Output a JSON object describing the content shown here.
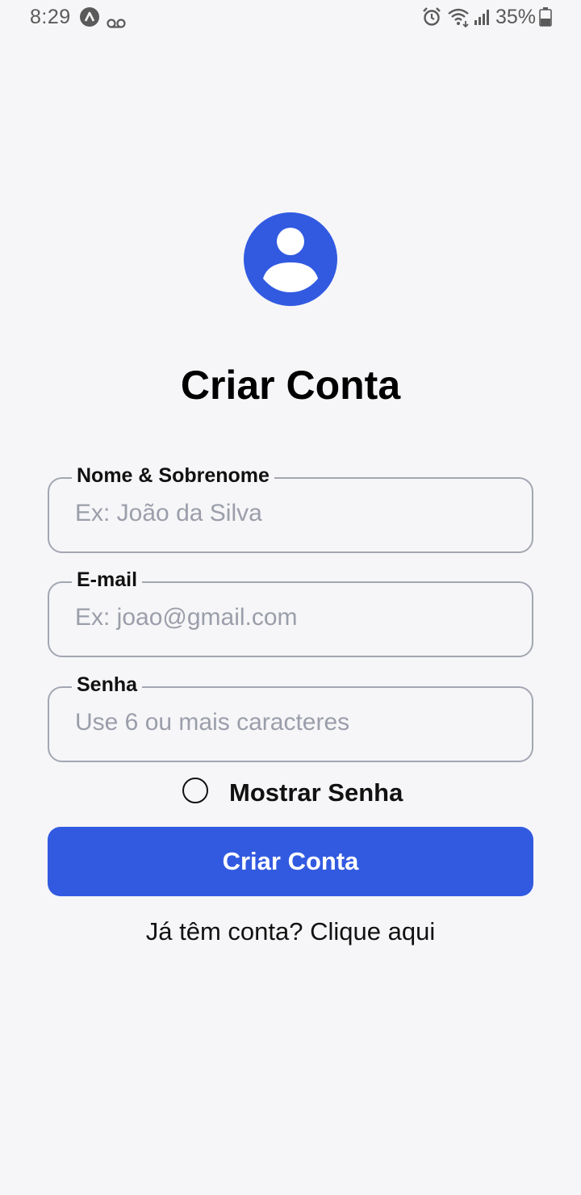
{
  "status_bar": {
    "time": "8:29",
    "battery": "35%",
    "icons": [
      "app-icon",
      "voicemail-icon",
      "alarm-icon",
      "wifi-icon",
      "signal-icon",
      "battery-icon"
    ]
  },
  "colors": {
    "accent": "#325ae1",
    "background": "#f6f6f8",
    "field_border": "#a3a6b3",
    "placeholder": "#9b9eaa"
  },
  "header": {
    "avatar_icon": "user-avatar-icon",
    "title": "Criar Conta"
  },
  "form": {
    "name": {
      "label": "Nome & Sobrenome",
      "placeholder": "Ex: João da Silva",
      "value": ""
    },
    "email": {
      "label": "E-mail",
      "placeholder": "Ex: joao@gmail.com",
      "value": ""
    },
    "password": {
      "label": "Senha",
      "placeholder": "Use 6 ou mais caracteres",
      "value": ""
    },
    "show_password": {
      "label": "Mostrar Senha",
      "checked": false
    },
    "submit_label": "Criar Conta"
  },
  "footer": {
    "login_link": "Já têm conta? Clique aqui"
  }
}
